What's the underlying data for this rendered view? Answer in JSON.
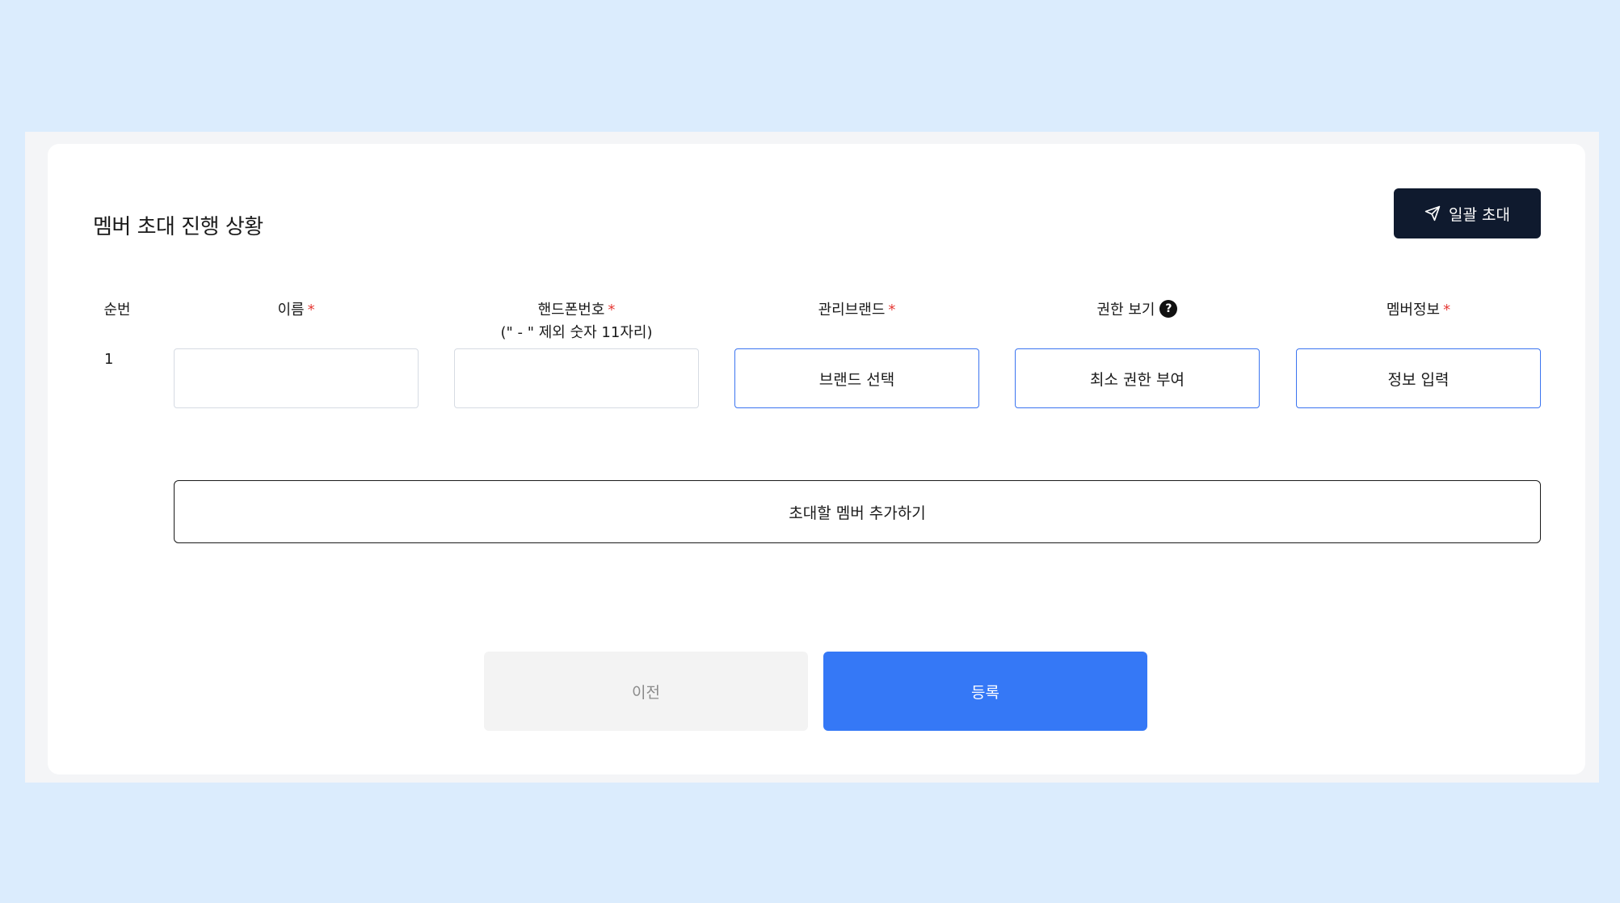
{
  "header": {
    "title": "멤버 초대 진행 상황",
    "bulk_invite_label": "일괄 초대",
    "bulk_invite_icon": "send-icon"
  },
  "table": {
    "columns": {
      "index": "순번",
      "name": "이름",
      "phone": "핸드폰번호",
      "phone_hint": "(\" - \" 제외 숫자 11자리)",
      "brand": "관리브랜드",
      "permission": "권한 보기",
      "member_info": "멤버정보"
    },
    "required_mark": "*",
    "help_icon_glyph": "?",
    "rows": [
      {
        "index": "1",
        "name": "",
        "phone": "",
        "brand_label": "브랜드 선택",
        "permission_label": "최소 권한 부여",
        "member_info_label": "정보 입력"
      }
    ]
  },
  "add_member_label": "초대할 멤버 추가하기",
  "footer": {
    "prev_label": "이전",
    "submit_label": "등록"
  },
  "colors": {
    "page_background": "#dbecfd",
    "primary": "#3578f6",
    "dark_button": "#0f1a2e",
    "required": "#e53935"
  }
}
